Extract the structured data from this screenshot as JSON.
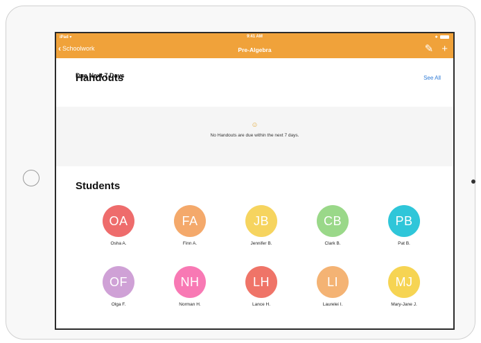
{
  "status": {
    "device": "iPad",
    "time": "9:41 AM"
  },
  "nav": {
    "back_label": "Schoolwork",
    "title": "Pre-Algebra"
  },
  "handouts": {
    "title": "Handouts",
    "see_all": "See All",
    "subheading": "Due Next 7 Days",
    "empty_emoji": "☺",
    "empty_message": "No Handouts are due within the next 7 days."
  },
  "students": {
    "title": "Students",
    "items": [
      {
        "initials": "OA",
        "name": "Osha A.",
        "color": "#ee6c6c"
      },
      {
        "initials": "FA",
        "name": "Finn A.",
        "color": "#f4a96b"
      },
      {
        "initials": "JB",
        "name": "Jennifer B.",
        "color": "#f6d45f"
      },
      {
        "initials": "CB",
        "name": "Clark B.",
        "color": "#9ad889"
      },
      {
        "initials": "PB",
        "name": "Pat B.",
        "color": "#2fc6d9"
      },
      {
        "initials": "OF",
        "name": "Olga F.",
        "color": "#cfa1d6"
      },
      {
        "initials": "NH",
        "name": "Norman H.",
        "color": "#f879b4"
      },
      {
        "initials": "LH",
        "name": "Lance H.",
        "color": "#ef7468"
      },
      {
        "initials": "LI",
        "name": "Laurelei I.",
        "color": "#f4b374"
      },
      {
        "initials": "MJ",
        "name": "Mary-Jane J.",
        "color": "#f6d453"
      }
    ]
  }
}
